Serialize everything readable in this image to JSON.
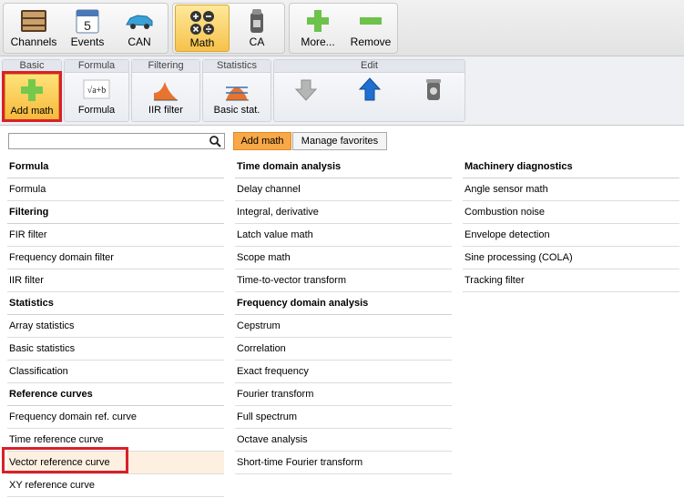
{
  "toolbar": {
    "channels": "Channels",
    "events": "Events",
    "can": "CAN",
    "math": "Math",
    "ca": "CA",
    "more": "More...",
    "remove": "Remove",
    "events_icon_text": "5",
    "math_icon_text": "+−×÷"
  },
  "ribbon": {
    "groups": {
      "basic": "Basic",
      "formula": "Formula",
      "filtering": "Filtering",
      "statistics": "Statistics",
      "edit": "Edit"
    },
    "buttons": {
      "add_math": "Add math",
      "formula": "Formula",
      "iir_filter": "IIR filter",
      "basic_stat": "Basic stat."
    },
    "formula_icon_text": "√a+b"
  },
  "search": {
    "value": "",
    "placeholder": ""
  },
  "tabs": {
    "add_math": "Add math",
    "manage_favorites": "Manage favorites"
  },
  "columns": [
    {
      "sections": [
        {
          "title": "Formula",
          "items": [
            "Formula"
          ]
        },
        {
          "title": "Filtering",
          "items": [
            "FIR filter",
            "Frequency domain filter",
            "IIR filter"
          ]
        },
        {
          "title": "Statistics",
          "items": [
            "Array statistics",
            "Basic statistics",
            "Classification"
          ]
        },
        {
          "title": "Reference curves",
          "items": [
            "Frequency domain ref. curve",
            "Time reference curve",
            "Vector reference curve",
            "XY reference curve"
          ]
        }
      ]
    },
    {
      "sections": [
        {
          "title": "Time domain analysis",
          "items": [
            "Delay channel",
            "Integral, derivative",
            "Latch value math",
            "Scope math",
            "Time-to-vector transform"
          ]
        },
        {
          "title": "Frequency domain analysis",
          "items": [
            "Cepstrum",
            "Correlation",
            "Exact frequency",
            "Fourier transform",
            "Full spectrum",
            "Octave analysis",
            "Short-time Fourier transform"
          ]
        }
      ]
    },
    {
      "sections": [
        {
          "title": "Machinery diagnostics",
          "items": [
            "Angle sensor math",
            "Combustion noise",
            "Envelope detection",
            "Sine processing (COLA)",
            "Tracking filter"
          ]
        }
      ]
    }
  ],
  "highlight": {
    "color": "#d9202a",
    "active_tab_color": "#f8a847",
    "selected_row_color": "#fdf0e1"
  }
}
